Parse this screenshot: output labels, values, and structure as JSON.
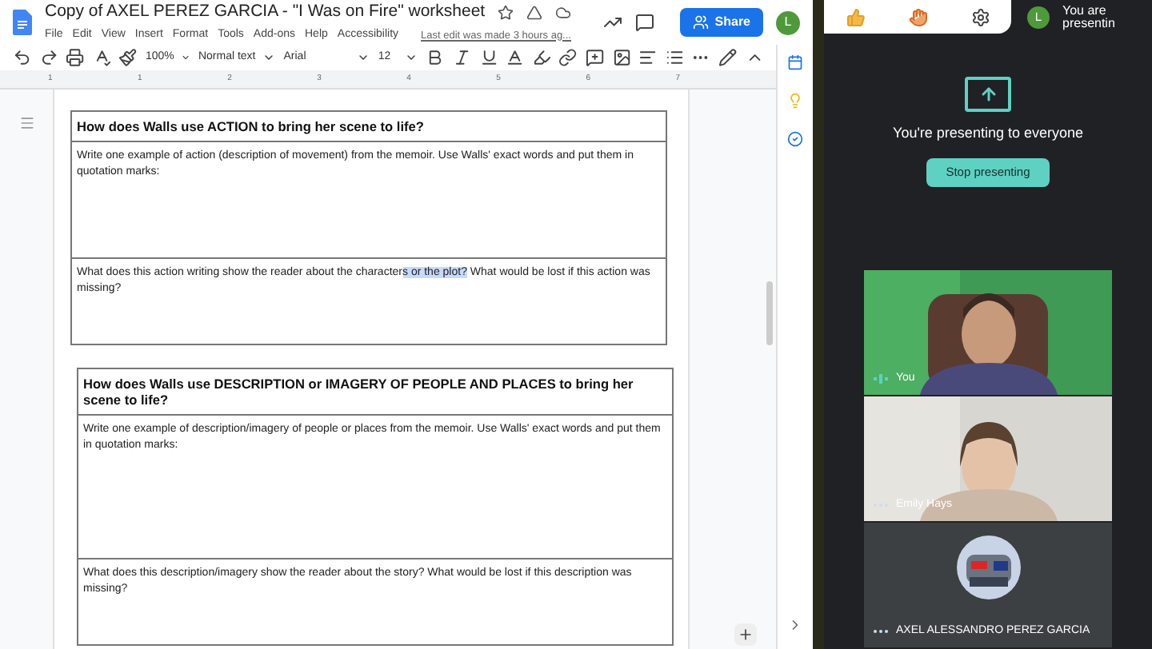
{
  "doc": {
    "title": "Copy of AXEL PEREZ GARCIA - \"I Was on Fire\" worksheet",
    "starred": false,
    "menu": [
      "File",
      "Edit",
      "View",
      "Insert",
      "Format",
      "Tools",
      "Add-ons",
      "Help",
      "Accessibility"
    ],
    "last_edit": "Last edit was made 3 hours ag...",
    "share": "Share",
    "avatar": "L",
    "toolbar": {
      "zoom": "100%",
      "style": "Normal text",
      "font": "Arial",
      "size": "12"
    },
    "ruler": [
      "1",
      "1",
      "2",
      "3",
      "4",
      "5",
      "6",
      "7"
    ],
    "sections": [
      {
        "heading": "How does Walls use ACTION to bring her scene to life?",
        "rows": [
          {
            "parts": [
              {
                "text": "Write one example of action (description of movement) from the memoir.  Use Walls' exact words and put them in quotation marks:",
                "selected": false
              }
            ]
          },
          {
            "parts": [
              {
                "text": "What does this action writing show the reader about the character",
                "selected": false
              },
              {
                "text": "s or the plot?",
                "selected": true
              },
              {
                "text": " What would be lost if this action was missing?",
                "selected": false
              }
            ]
          }
        ]
      },
      {
        "heading": "How does Walls use DESCRIPTION or IMAGERY OF PEOPLE AND PLACES to bring her scene to life?",
        "rows": [
          {
            "parts": [
              {
                "text": "Write one example of description/imagery of people or places from the memoir.  Use Walls' exact words and put them in quotation marks:",
                "selected": false
              }
            ]
          },
          {
            "parts": [
              {
                "text": "What does this description/imagery show the reader about the story? What would be lost if this description was missing?",
                "selected": false
              }
            ]
          }
        ]
      }
    ]
  },
  "meet": {
    "avatar": "L",
    "status": "You are presentin",
    "presenting": "You're presenting to everyone",
    "stop": "Stop presenting",
    "participants": [
      {
        "name": "You",
        "kind": "video",
        "speaking": true
      },
      {
        "name": "Emily Hays",
        "kind": "video",
        "speaking": false
      },
      {
        "name": "AXEL ALESSANDRO PEREZ GARCIA",
        "kind": "avatar",
        "speaking": false
      }
    ]
  }
}
